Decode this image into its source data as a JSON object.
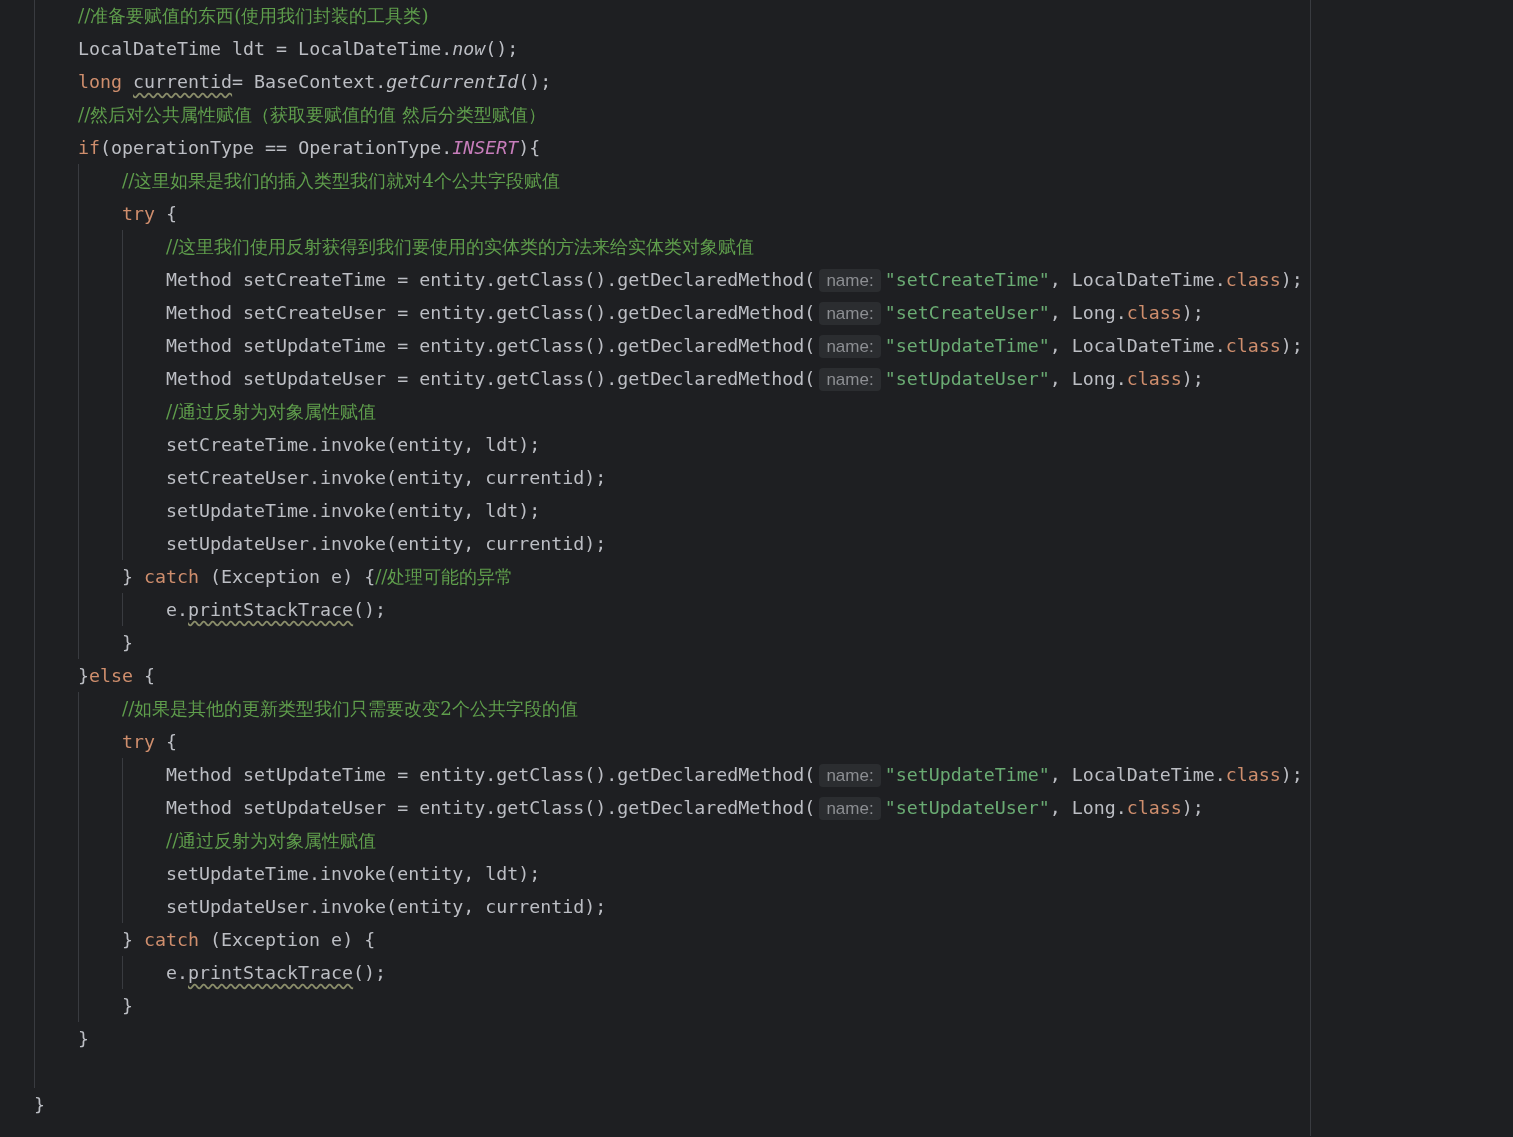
{
  "code": [
    {
      "kind": "block",
      "children": [
        {
          "kind": "line",
          "tokens": [
            {
              "kind": "comment",
              "text": "//准备要赋值的东西(使用我们封装的工具类)"
            }
          ]
        },
        {
          "kind": "line",
          "tokens": [
            {
              "kind": "code",
              "text": "LocalDateTime ldt = LocalDateTime."
            },
            {
              "kind": "call",
              "text": "now"
            },
            {
              "kind": "code",
              "text": "();"
            }
          ]
        },
        {
          "kind": "line",
          "tokens": [
            {
              "kind": "keyword",
              "text": "long "
            },
            {
              "kind": "flagged",
              "text": "currentid"
            },
            {
              "kind": "code",
              "text": "= BaseContext."
            },
            {
              "kind": "call",
              "text": "getCurrentId"
            },
            {
              "kind": "code",
              "text": "();"
            }
          ]
        },
        {
          "kind": "line",
          "tokens": [
            {
              "kind": "comment",
              "text": "//然后对公共属性赋值（获取要赋值的值 然后分类型赋值）"
            }
          ]
        },
        {
          "kind": "line",
          "tokens": [
            {
              "kind": "keyword",
              "text": "if"
            },
            {
              "kind": "code",
              "text": "(operationType == OperationType."
            },
            {
              "kind": "constant",
              "text": "INSERT"
            },
            {
              "kind": "code",
              "text": "){"
            }
          ]
        },
        {
          "kind": "block",
          "children": [
            {
              "kind": "line",
              "tokens": [
                {
                  "kind": "comment",
                  "text": "//这里如果是我们的插入类型我们就对4个公共字段赋值"
                }
              ]
            },
            {
              "kind": "line",
              "tokens": [
                {
                  "kind": "keyword",
                  "text": "try"
                },
                {
                  "kind": "code",
                  "text": " {"
                }
              ]
            },
            {
              "kind": "block",
              "children": [
                {
                  "kind": "line",
                  "tokens": [
                    {
                      "kind": "comment",
                      "text": "//这里我们使用反射获得到我们要使用的实体类的方法来给实体类对象赋值"
                    }
                  ]
                },
                {
                  "kind": "line",
                  "tokens": [
                    {
                      "kind": "code",
                      "text": "Method setCreateTime = entity.getClass().getDeclaredMethod("
                    },
                    {
                      "kind": "hint",
                      "text": "name:"
                    },
                    {
                      "kind": "string",
                      "text": "\"setCreateTime\""
                    },
                    {
                      "kind": "code",
                      "text": ", LocalDateTime."
                    },
                    {
                      "kind": "keyword",
                      "text": "class"
                    },
                    {
                      "kind": "code",
                      "text": ");"
                    }
                  ]
                },
                {
                  "kind": "line",
                  "tokens": [
                    {
                      "kind": "code",
                      "text": "Method setCreateUser = entity.getClass().getDeclaredMethod("
                    },
                    {
                      "kind": "hint",
                      "text": "name:"
                    },
                    {
                      "kind": "string",
                      "text": "\"setCreateUser\""
                    },
                    {
                      "kind": "code",
                      "text": ", Long."
                    },
                    {
                      "kind": "keyword",
                      "text": "class"
                    },
                    {
                      "kind": "code",
                      "text": ");"
                    }
                  ]
                },
                {
                  "kind": "line",
                  "tokens": [
                    {
                      "kind": "code",
                      "text": "Method setUpdateTime = entity.getClass().getDeclaredMethod("
                    },
                    {
                      "kind": "hint",
                      "text": "name:"
                    },
                    {
                      "kind": "string",
                      "text": "\"setUpdateTime\""
                    },
                    {
                      "kind": "code",
                      "text": ", LocalDateTime."
                    },
                    {
                      "kind": "keyword",
                      "text": "class"
                    },
                    {
                      "kind": "code",
                      "text": ");"
                    }
                  ]
                },
                {
                  "kind": "line",
                  "tokens": [
                    {
                      "kind": "code",
                      "text": "Method setUpdateUser = entity.getClass().getDeclaredMethod("
                    },
                    {
                      "kind": "hint",
                      "text": "name:"
                    },
                    {
                      "kind": "string",
                      "text": "\"setUpdateUser\""
                    },
                    {
                      "kind": "code",
                      "text": ", Long."
                    },
                    {
                      "kind": "keyword",
                      "text": "class"
                    },
                    {
                      "kind": "code",
                      "text": ");"
                    }
                  ]
                },
                {
                  "kind": "line",
                  "tokens": [
                    {
                      "kind": "comment",
                      "text": "//通过反射为对象属性赋值"
                    }
                  ]
                },
                {
                  "kind": "line",
                  "tokens": [
                    {
                      "kind": "code",
                      "text": "setCreateTime.invoke(entity, ldt);"
                    }
                  ]
                },
                {
                  "kind": "line",
                  "tokens": [
                    {
                      "kind": "code",
                      "text": "setCreateUser.invoke(entity, currentid);"
                    }
                  ]
                },
                {
                  "kind": "line",
                  "tokens": [
                    {
                      "kind": "code",
                      "text": "setUpdateTime.invoke(entity, ldt);"
                    }
                  ]
                },
                {
                  "kind": "line",
                  "tokens": [
                    {
                      "kind": "code",
                      "text": "setUpdateUser.invoke(entity, currentid);"
                    }
                  ]
                }
              ]
            },
            {
              "kind": "line",
              "tokens": [
                {
                  "kind": "code",
                  "text": "} "
                },
                {
                  "kind": "keyword",
                  "text": "catch"
                },
                {
                  "kind": "code",
                  "text": " (Exception e) {"
                },
                {
                  "kind": "comment",
                  "text": "//处理可能的异常"
                }
              ]
            },
            {
              "kind": "block",
              "children": [
                {
                  "kind": "line",
                  "tokens": [
                    {
                      "kind": "code",
                      "text": "e."
                    },
                    {
                      "kind": "flagged",
                      "text": "printStackTrace"
                    },
                    {
                      "kind": "code",
                      "text": "();"
                    }
                  ]
                }
              ]
            },
            {
              "kind": "line",
              "tokens": [
                {
                  "kind": "code",
                  "text": "}"
                }
              ]
            }
          ]
        },
        {
          "kind": "line",
          "tokens": [
            {
              "kind": "code",
              "text": "}"
            },
            {
              "kind": "keyword",
              "text": "else"
            },
            {
              "kind": "code",
              "text": " {"
            }
          ]
        },
        {
          "kind": "block",
          "children": [
            {
              "kind": "line",
              "tokens": [
                {
                  "kind": "comment",
                  "text": "//如果是其他的更新类型我们只需要改变2个公共字段的值"
                }
              ]
            },
            {
              "kind": "line",
              "tokens": [
                {
                  "kind": "keyword",
                  "text": "try"
                },
                {
                  "kind": "code",
                  "text": " {"
                }
              ]
            },
            {
              "kind": "block",
              "children": [
                {
                  "kind": "line",
                  "tokens": [
                    {
                      "kind": "code",
                      "text": "Method setUpdateTime = entity.getClass().getDeclaredMethod("
                    },
                    {
                      "kind": "hint",
                      "text": "name:"
                    },
                    {
                      "kind": "string",
                      "text": "\"setUpdateTime\""
                    },
                    {
                      "kind": "code",
                      "text": ", LocalDateTime."
                    },
                    {
                      "kind": "keyword",
                      "text": "class"
                    },
                    {
                      "kind": "code",
                      "text": ");"
                    }
                  ]
                },
                {
                  "kind": "line",
                  "tokens": [
                    {
                      "kind": "code",
                      "text": "Method setUpdateUser = entity.getClass().getDeclaredMethod("
                    },
                    {
                      "kind": "hint",
                      "text": "name:"
                    },
                    {
                      "kind": "string",
                      "text": "\"setUpdateUser\""
                    },
                    {
                      "kind": "code",
                      "text": ", Long."
                    },
                    {
                      "kind": "keyword",
                      "text": "class"
                    },
                    {
                      "kind": "code",
                      "text": ");"
                    }
                  ]
                },
                {
                  "kind": "line",
                  "tokens": [
                    {
                      "kind": "comment",
                      "text": "//通过反射为对象属性赋值"
                    }
                  ]
                },
                {
                  "kind": "line",
                  "tokens": [
                    {
                      "kind": "code",
                      "text": "setUpdateTime.invoke(entity, ldt);"
                    }
                  ]
                },
                {
                  "kind": "line",
                  "tokens": [
                    {
                      "kind": "code",
                      "text": "setUpdateUser.invoke(entity, currentid);"
                    }
                  ]
                }
              ]
            },
            {
              "kind": "line",
              "tokens": [
                {
                  "kind": "code",
                  "text": "} "
                },
                {
                  "kind": "keyword",
                  "text": "catch"
                },
                {
                  "kind": "code",
                  "text": " (Exception e) {"
                }
              ]
            },
            {
              "kind": "block",
              "children": [
                {
                  "kind": "line",
                  "tokens": [
                    {
                      "kind": "code",
                      "text": "e."
                    },
                    {
                      "kind": "flagged",
                      "text": "printStackTrace"
                    },
                    {
                      "kind": "code",
                      "text": "();"
                    }
                  ]
                }
              ]
            },
            {
              "kind": "line",
              "tokens": [
                {
                  "kind": "code",
                  "text": "}"
                }
              ]
            }
          ]
        },
        {
          "kind": "line",
          "tokens": [
            {
              "kind": "code",
              "text": "}"
            }
          ]
        },
        {
          "kind": "blank"
        }
      ]
    },
    {
      "kind": "line",
      "tokens": [
        {
          "kind": "code",
          "text": "}"
        }
      ]
    }
  ]
}
